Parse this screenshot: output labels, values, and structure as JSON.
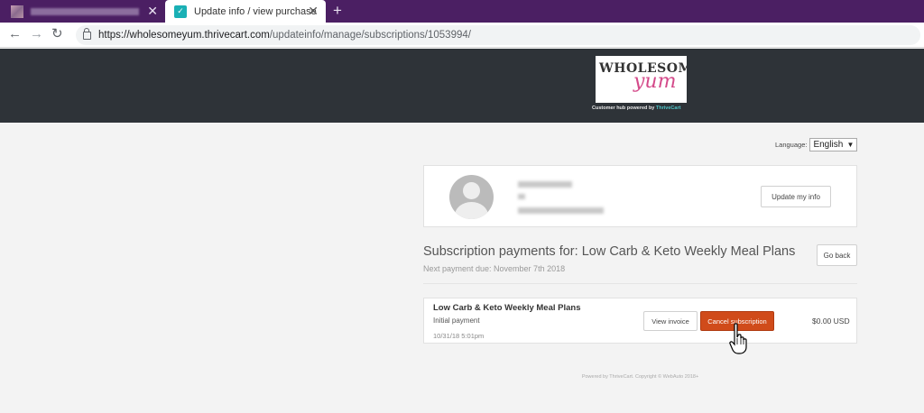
{
  "browser": {
    "tabs": [
      {
        "title": "",
        "active": false
      },
      {
        "title": "Update info / view purchase history",
        "active": true
      }
    ],
    "url_host": "https://wholesomeyum.thrivecart.com",
    "url_path": "/updateinfo/manage/subscriptions/1053994/",
    "icons": {
      "back": "arrow-left-icon",
      "forward": "arrow-right-icon",
      "reload": "reload-icon",
      "lock": "lock-icon",
      "close": "close-icon",
      "new_tab": "plus-icon"
    }
  },
  "header": {
    "logo_text": "WHOLESOME",
    "logo_script": "yum",
    "powered_prefix": "Customer hub powered by",
    "powered_brand": "ThriveCart",
    "colors": {
      "background": "#2e3338",
      "logo_pink": "#d44a8a",
      "brand_teal": "#4fc6c9"
    }
  },
  "language": {
    "label": "Language:",
    "selected": "English"
  },
  "profile": {
    "update_button": "Update my info"
  },
  "subscription": {
    "title": "Subscription payments for: Low Carb & Keto Weekly Meal Plans",
    "next_payment": "Next payment due: November 7th 2018",
    "go_back": "Go back",
    "plan": {
      "name": "Low Carb & Keto Weekly Meal Plans",
      "type": "Initial payment",
      "date": "10/31/18 5:01pm",
      "view_invoice": "View invoice",
      "cancel": "Cancel subscription",
      "price": "$0.00 USD"
    },
    "colors": {
      "cancel": "#d04b1a"
    }
  },
  "footer": {
    "text": "Powered by ThriveCart. Copyright © WebAuto 2018+"
  }
}
